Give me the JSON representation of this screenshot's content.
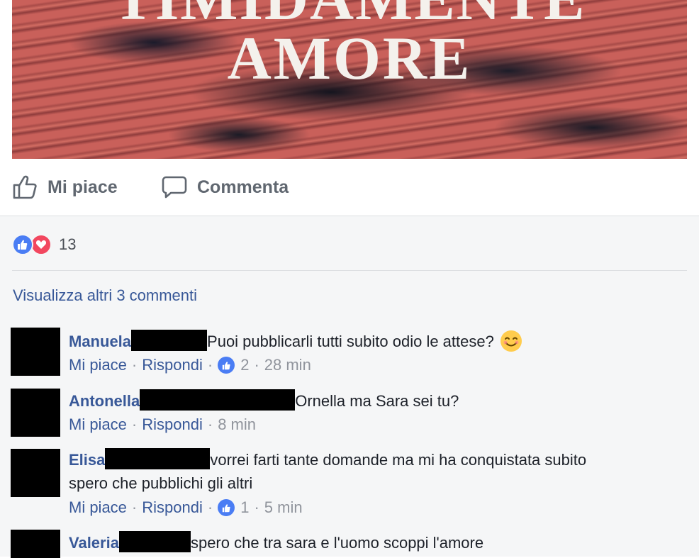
{
  "cover": {
    "title_line1": "TIMIDAMENTE",
    "title_line2": "AMORE"
  },
  "actions": {
    "like_label": "Mi piace",
    "comment_label": "Commenta"
  },
  "reactions": {
    "count": "13",
    "types": [
      "like-icon",
      "love-icon"
    ]
  },
  "view_more": "Visualizza altri 3 commenti",
  "comments": [
    {
      "author": "Manuela",
      "text": "Puoi pubblicarli tutti subito odio le attese?",
      "emoji": "smiling-face-icon",
      "like_label": "Mi piace",
      "reply_label": "Rispondi",
      "likes": "2",
      "time": "28 min"
    },
    {
      "author": "Antonella",
      "text": "Ornella ma Sara sei tu?",
      "like_label": "Mi piace",
      "reply_label": "Rispondi",
      "time": "8 min"
    },
    {
      "author": "Elisa",
      "text": "vorrei farti tante domande ma mi ha conquistata subito",
      "text_line2": "spero che pubblichi gli altri",
      "like_label": "Mi piace",
      "reply_label": "Rispondi",
      "likes": "1",
      "time": "5 min"
    },
    {
      "author": "Valeria",
      "text": "spero che tra sara e l'uomo scoppi l'amore"
    }
  ],
  "meta_separator": "·",
  "colors": {
    "link": "#385898",
    "muted": "#90949c",
    "like_blue": "#4a7df4",
    "love_red": "#f2475f",
    "panel_bg": "#f5f6f7"
  }
}
